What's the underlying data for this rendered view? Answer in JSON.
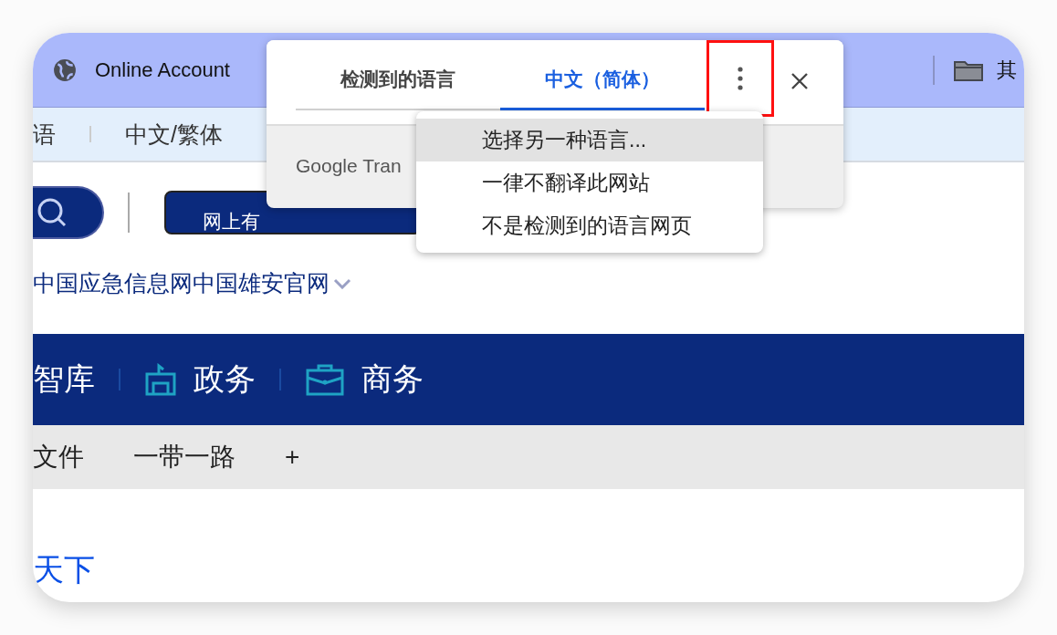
{
  "bookmarks_bar": {
    "site": "Online Account",
    "folder": "其"
  },
  "language_bar": {
    "items": [
      "语",
      "中文/繁体"
    ]
  },
  "report_button": "网上有",
  "site_links": "中国应急信息网中国雄安官网",
  "nav": [
    {
      "label": "智库",
      "kind": "text"
    },
    {
      "label": "政务",
      "kind": "building"
    },
    {
      "label": "商务",
      "kind": "briefcase"
    }
  ],
  "subnav": [
    "文件",
    "一带一路",
    "+"
  ],
  "headline": "天下",
  "translate_popup": {
    "tabs": [
      {
        "label": "检测到的语言",
        "selected": false
      },
      {
        "label": "中文（简体）",
        "selected": true
      }
    ],
    "more_highlighted": true,
    "footer": "Google Tran"
  },
  "menu": {
    "items": [
      {
        "label": "选择另一种语言...",
        "selected": true
      },
      {
        "label": "一律不翻译此网站",
        "selected": false
      },
      {
        "label": "不是检测到的语言网页",
        "selected": false
      }
    ]
  }
}
